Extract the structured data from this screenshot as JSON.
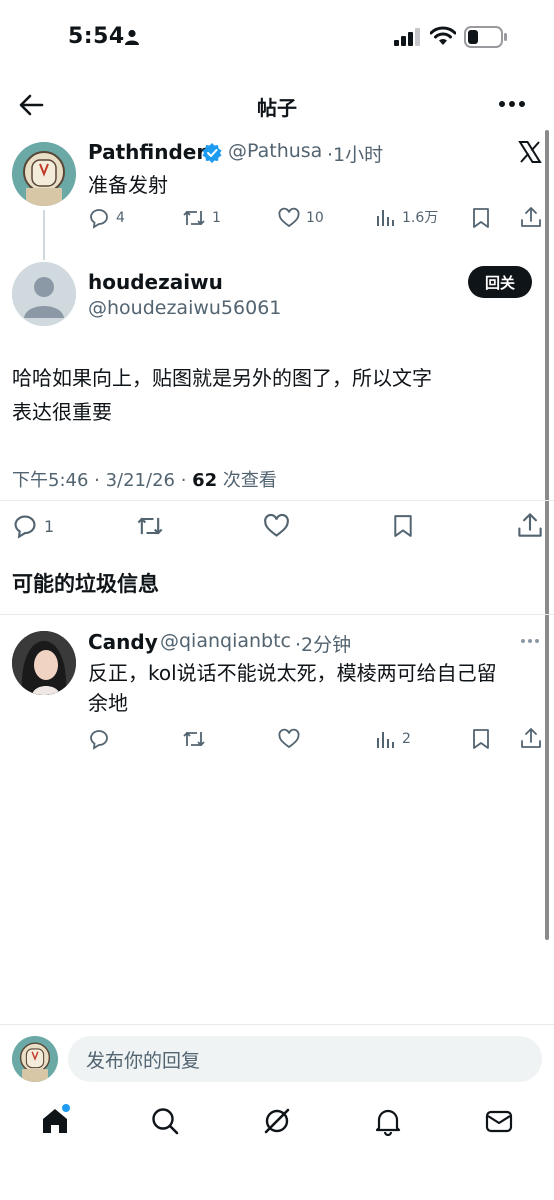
{
  "status_bar": {
    "time": "5:54"
  },
  "header": {
    "title": "帖子"
  },
  "parent_tweet": {
    "name": "Pathfinder",
    "handle": "@Pathusa",
    "time": "·1小时",
    "text": "准备发射",
    "stats": {
      "replies": "4",
      "retweets": "1",
      "likes": "10",
      "views": "1.6万"
    }
  },
  "main_tweet": {
    "name": "houdezaiwu",
    "handle": "@houdezaiwu56061",
    "follow_label": "回关",
    "text_line1": "哈哈如果向上，贴图就是另外的图了，所以文字",
    "text_line2": "表达很重要",
    "meta_time": "下午5:46 · 3/21/26 · ",
    "meta_views": "62",
    "meta_views_label": " 次查看",
    "stats": {
      "replies": "1"
    }
  },
  "section": {
    "spam_heading": "可能的垃圾信息"
  },
  "reply": {
    "name": "Candy",
    "handle": "@qianqianbtc",
    "time": "·2分钟",
    "text_line1": "反正，kol说话不能说太死，模棱两可给自己留",
    "text_line2": "余地",
    "stats": {
      "views": "2"
    }
  },
  "composer": {
    "placeholder": "发布你的回复"
  },
  "colors": {
    "verified": "#1d9bf0",
    "text": "#0f1419",
    "muted": "#536471",
    "accent": "#1d9bf0"
  }
}
